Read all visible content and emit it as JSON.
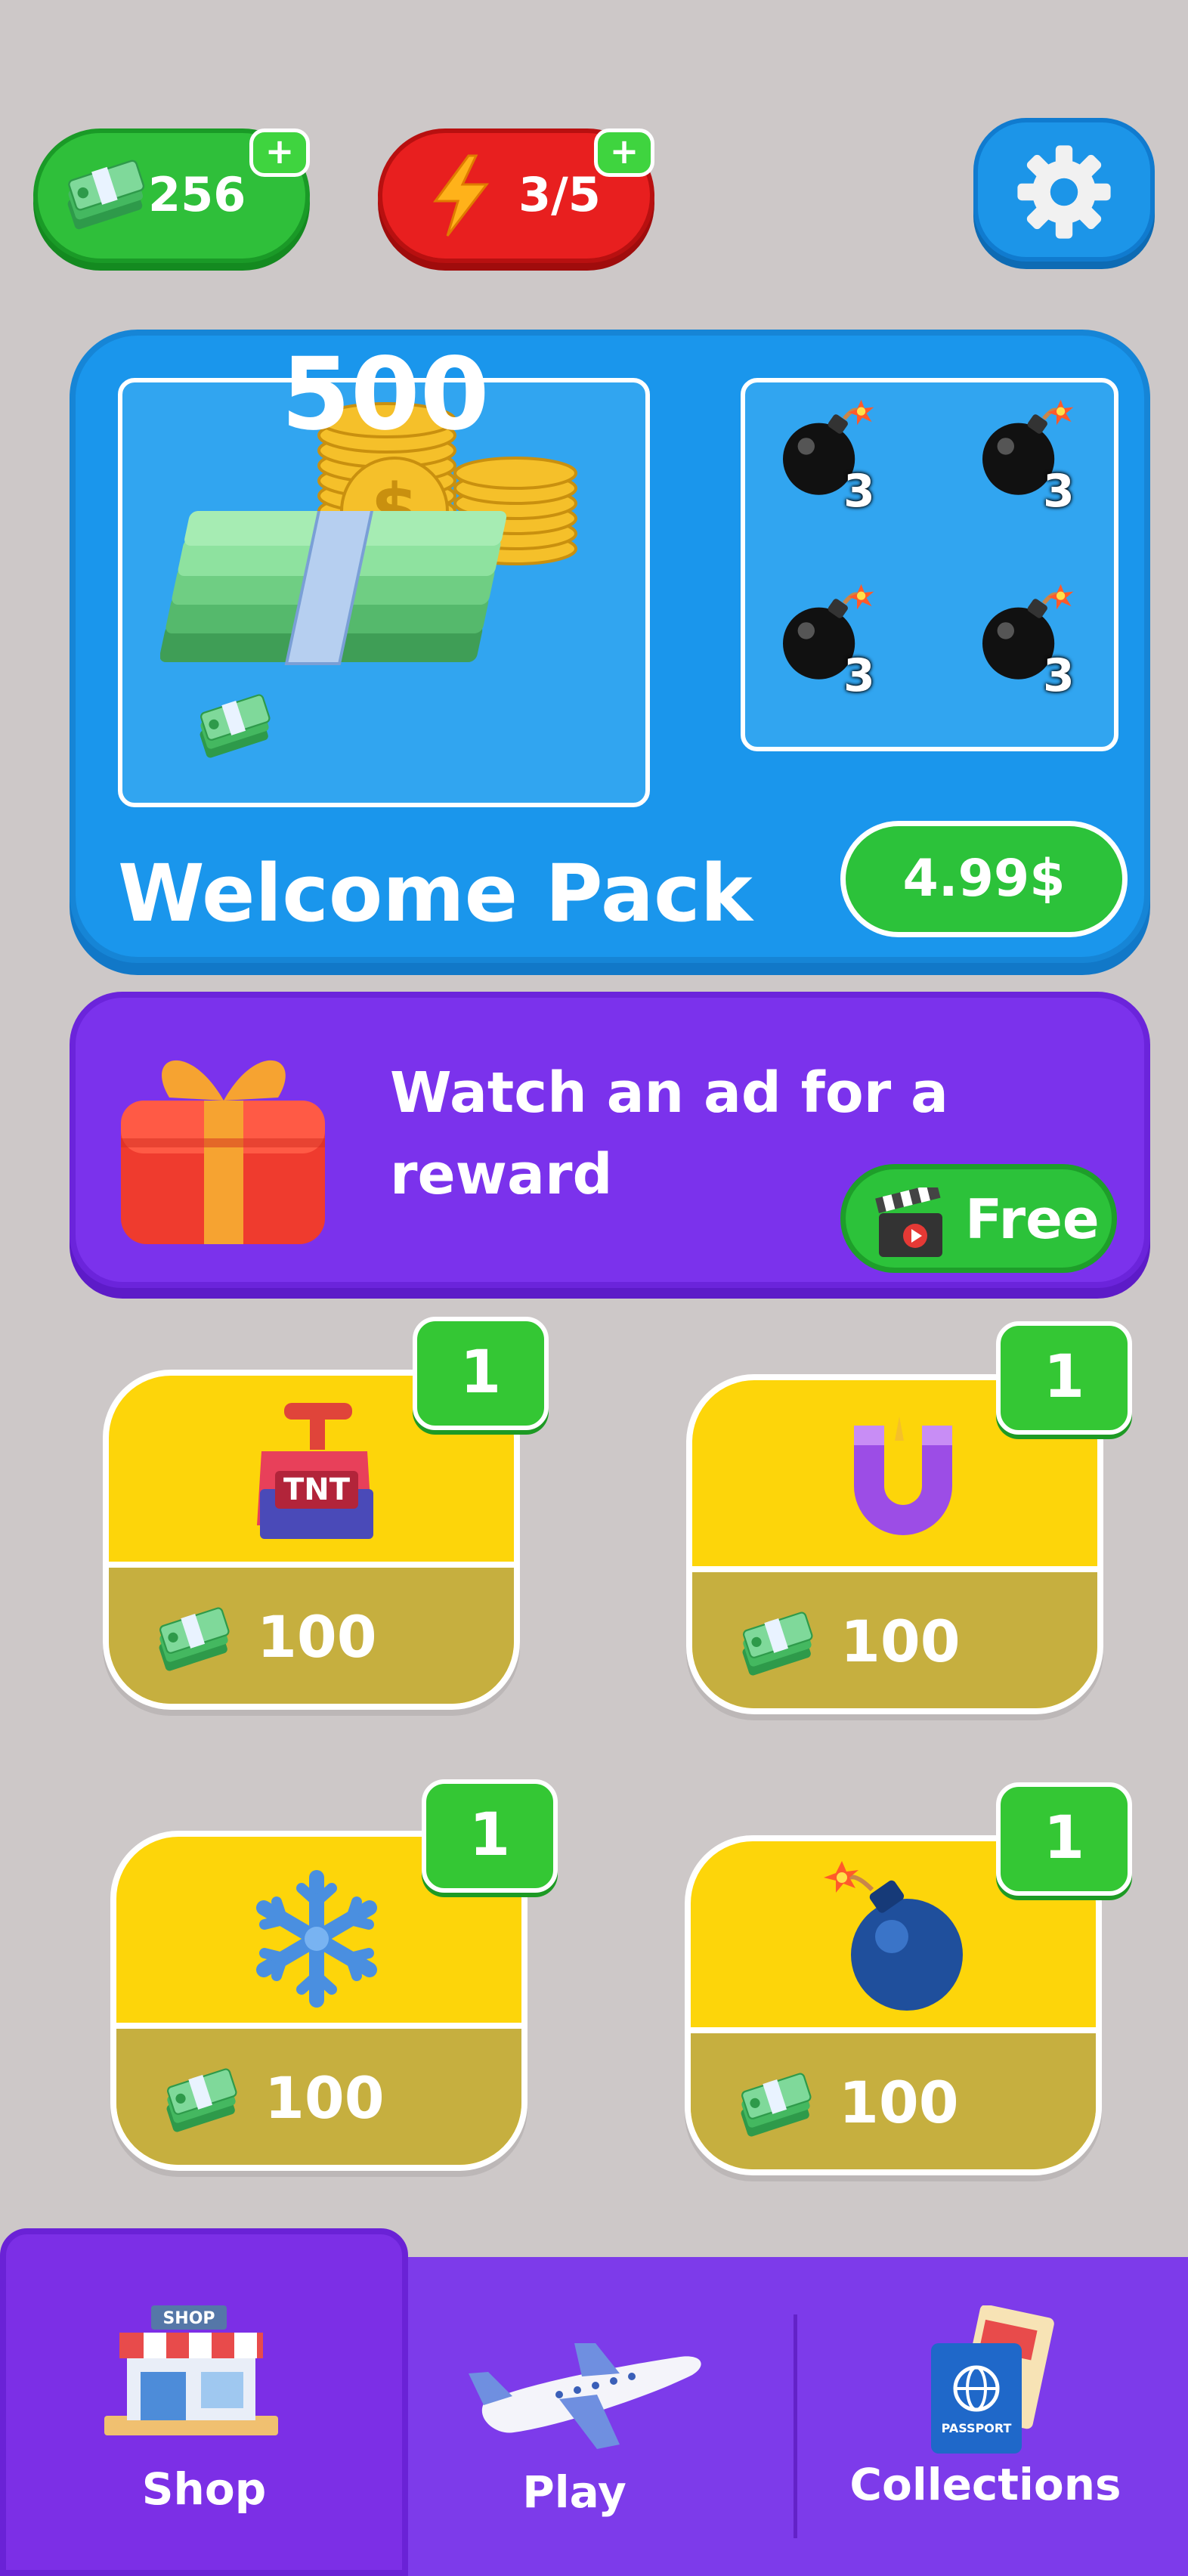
{
  "header": {
    "money": {
      "value": "256",
      "plus": "+"
    },
    "energy": {
      "value": "3/5",
      "plus": "+"
    }
  },
  "welcome_pack": {
    "title": "Welcome Pack",
    "cash_amount": "500",
    "bombs": [
      {
        "count": "3"
      },
      {
        "count": "3"
      },
      {
        "count": "3"
      },
      {
        "count": "3"
      }
    ],
    "price_label": "4.99$"
  },
  "ad_offer": {
    "text": "Watch an ad for a reward",
    "button_label": "Free"
  },
  "shop_items": [
    {
      "item": "tnt",
      "badge": "1",
      "price": "100"
    },
    {
      "item": "magnet",
      "badge": "1",
      "price": "100"
    },
    {
      "item": "snowflake",
      "badge": "1",
      "price": "100"
    },
    {
      "item": "bomb",
      "badge": "1",
      "price": "100"
    }
  ],
  "nav": {
    "tabs": [
      {
        "label": "Shop",
        "active": true
      },
      {
        "label": "Play",
        "active": false
      },
      {
        "label": "Collections",
        "active": false
      }
    ]
  },
  "colors": {
    "background": "#cdc8c8",
    "money_pill": "#2fbf3a",
    "energy_pill": "#e81f1f",
    "welcome_bg": "#1a96ec",
    "ad_bg": "#7b32ec",
    "card_top": "#fdd50a",
    "card_bottom": "#c6af3f",
    "nav_bg": "#7d3bea"
  }
}
